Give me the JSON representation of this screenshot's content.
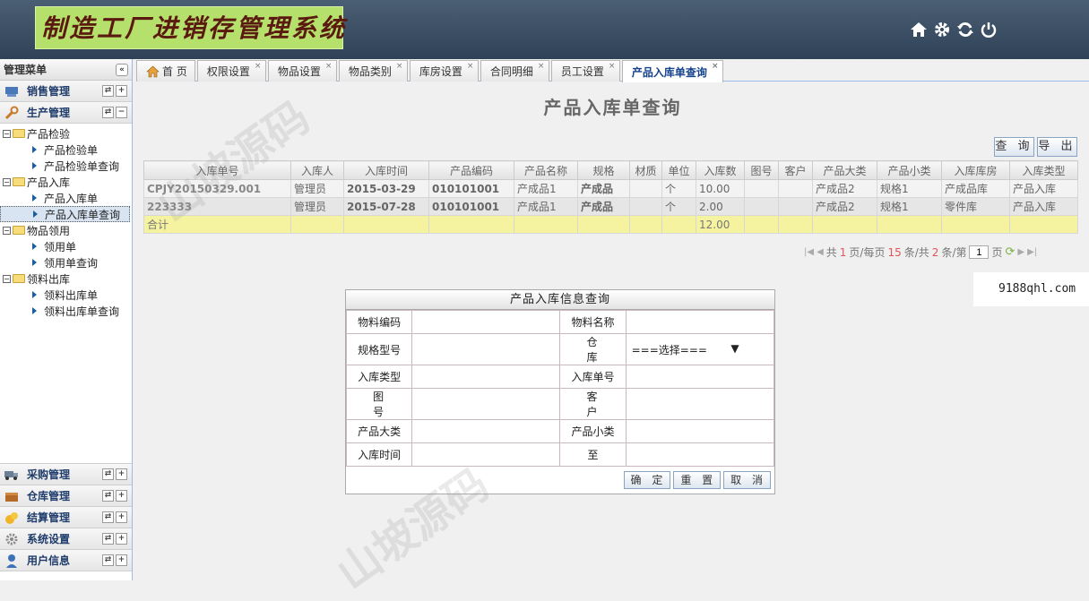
{
  "app": {
    "logo_text": "制造工厂进销存管理系统"
  },
  "header_icons": [
    "home-icon",
    "gear-icon",
    "refresh-icon",
    "power-icon"
  ],
  "sidebar": {
    "title": "管理菜单",
    "collapse": "«",
    "top_groups": [
      {
        "label": "销售管理",
        "icon": "sales-icon"
      },
      {
        "label": "生产管理",
        "icon": "wrench-icon"
      }
    ],
    "tree": [
      {
        "label": "产品检验",
        "type": "folder"
      },
      {
        "label": "产品检验单",
        "type": "leaf"
      },
      {
        "label": "产品检验单查询",
        "type": "leaf"
      },
      {
        "label": "产品入库",
        "type": "folder"
      },
      {
        "label": "产品入库单",
        "type": "leaf"
      },
      {
        "label": "产品入库单查询",
        "type": "leaf",
        "selected": true
      },
      {
        "label": "物品领用",
        "type": "folder"
      },
      {
        "label": "领用单",
        "type": "leaf"
      },
      {
        "label": "领用单查询",
        "type": "leaf"
      },
      {
        "label": "领料出库",
        "type": "folder"
      },
      {
        "label": "领料出库单",
        "type": "leaf"
      },
      {
        "label": "领料出库单查询",
        "type": "leaf"
      }
    ],
    "bottom_groups": [
      {
        "label": "采购管理",
        "icon": "truck-icon"
      },
      {
        "label": "仓库管理",
        "icon": "warehouse-icon"
      },
      {
        "label": "结算管理",
        "icon": "coins-icon"
      },
      {
        "label": "系统设置",
        "icon": "settings-icon"
      },
      {
        "label": "用户信息",
        "icon": "user-icon"
      }
    ]
  },
  "tabs": [
    {
      "label": "首 页",
      "closable": false
    },
    {
      "label": "权限设置",
      "closable": true
    },
    {
      "label": "物品设置",
      "closable": true
    },
    {
      "label": "物品类别",
      "closable": true
    },
    {
      "label": "库房设置",
      "closable": true
    },
    {
      "label": "合同明细",
      "closable": true
    },
    {
      "label": "员工设置",
      "closable": true
    },
    {
      "label": "产品入库单查询",
      "closable": true,
      "active": true
    }
  ],
  "page": {
    "title": "产品入库单查询",
    "query_button": "查 询",
    "export_button": "导 出"
  },
  "grid": {
    "columns": [
      "入库单号",
      "入库人",
      "入库时间",
      "产品编码",
      "产品名称",
      "规格",
      "材质",
      "单位",
      "入库数",
      "图号",
      "客户",
      "产品大类",
      "产品小类",
      "入库库房",
      "入库类型"
    ],
    "rows": [
      [
        "CPJY20150329.001",
        "管理员",
        "2015-03-29",
        "010101001",
        "产成品1",
        "产成品",
        "",
        "个",
        "10.00",
        "",
        "",
        "产成品2",
        "规格1",
        "产成品库",
        "产品入库"
      ],
      [
        "223333",
        "管理员",
        "2015-07-28",
        "010101001",
        "产成品1",
        "产成品",
        "",
        "个",
        "2.00",
        "",
        "",
        "产成品2",
        "规格1",
        "零件库",
        "产品入库"
      ]
    ],
    "summary": {
      "label": "合计",
      "total_qty": "12.00"
    }
  },
  "pager": {
    "text_total_pages_prefix": "共",
    "total_pages": "1",
    "text_pages_suffix": "页/每页",
    "page_size": "15",
    "text_items_prefix": "条/共",
    "total_items": "2",
    "text_items_suffix": "条/第",
    "current_page": "1",
    "text_page": "页"
  },
  "site_mark": "9188qhl.com",
  "query_form": {
    "title": "产品入库信息查询",
    "rows": [
      {
        "l1": "物料编码",
        "l2": "物料名称"
      },
      {
        "l1": "规格型号",
        "l2": "仓  库",
        "select": "===选择==="
      },
      {
        "l1": "入库类型",
        "l2": "入库单号"
      },
      {
        "l1": "图  号",
        "l2": "客  户"
      },
      {
        "l1": "产品大类",
        "l2": "产品小类"
      },
      {
        "l1": "入库时间",
        "l2": "至"
      }
    ],
    "buttons": {
      "ok": "确 定",
      "reset": "重 置",
      "cancel": "取 消"
    }
  },
  "watermark": "山坡源码",
  "colors": {
    "header": "#3b4f66",
    "logo_bg": "#b5e06b",
    "summary_row": "#f5f3a0",
    "accent": "#15428b"
  }
}
